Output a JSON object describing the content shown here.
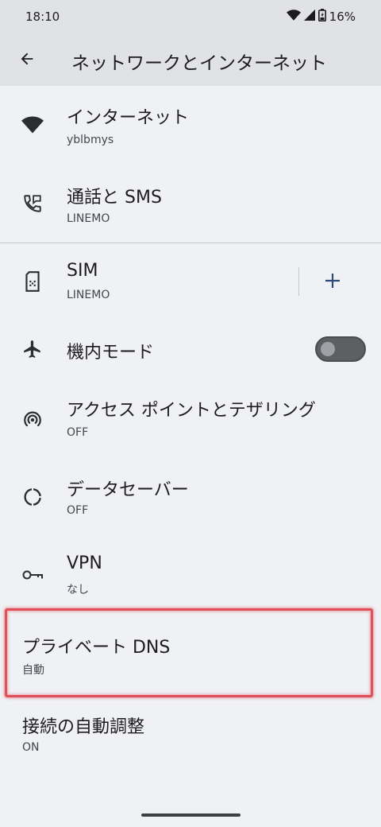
{
  "status_bar": {
    "time": "18:10",
    "battery": "16%",
    "icons": [
      "wifi-icon",
      "signal-icon",
      "battery-icon"
    ]
  },
  "toolbar": {
    "back_icon": "arrow-back-icon",
    "title": "ネットワークとインターネット"
  },
  "items": [
    {
      "title": "インターネット",
      "summary": "yblbmys",
      "icon": "wifi-icon"
    },
    {
      "title": "通話と SMS",
      "summary": "LINEMO",
      "icon": "call-sms-icon"
    },
    {
      "title": "SIM",
      "summary": "LINEMO",
      "icon": "sim-icon",
      "action_icon": "plus-icon"
    },
    {
      "title": "機内モード",
      "icon": "airplane-icon",
      "toggle_on": false
    },
    {
      "title": "アクセス ポイントとテザリング",
      "summary": "OFF",
      "icon": "hotspot-icon"
    },
    {
      "title": "データセーバー",
      "summary": "OFF",
      "icon": "data-saver-icon"
    },
    {
      "title": "VPN",
      "summary": "なし",
      "icon": "vpn-key-icon"
    },
    {
      "title": "プライベート DNS",
      "summary": "自動"
    },
    {
      "title": "接続の自動調整",
      "summary": "ON"
    }
  ],
  "colors": {
    "background": "#eff1f4",
    "header": "#e0e2e6",
    "accent": "#2f4a77",
    "highlight": "#e0505a"
  }
}
